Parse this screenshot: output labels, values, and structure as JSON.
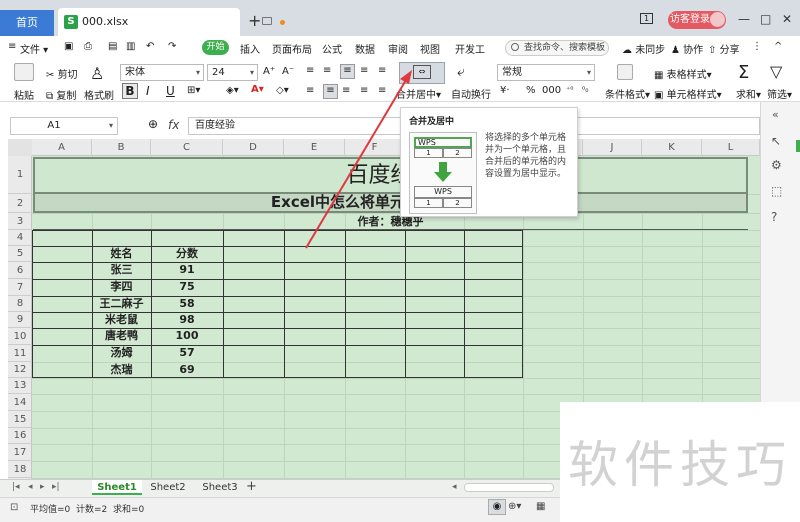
{
  "tabbar": {
    "home_label": "首页",
    "doc_label": "000.xlsx",
    "new_tab": "+",
    "login_label": "访客登录",
    "win_min": "—",
    "win_max": "□",
    "win_close": "✕",
    "win_badge": "1"
  },
  "menu": {
    "file": "文件",
    "start": "开始",
    "items": [
      "插入",
      "页面布局",
      "公式",
      "数据",
      "审阅",
      "视图",
      "开发工"
    ],
    "search": "查找命令、搜索模板",
    "unsync": "未同步",
    "collab": "协作",
    "share": "分享"
  },
  "ribbon": {
    "cut": "剪切",
    "paste": "粘贴",
    "copy": "复制",
    "format_painter": "格式刷",
    "font_name": "宋体",
    "font_size": "24",
    "bold": "B",
    "italic": "I",
    "underline": "U",
    "merge": "合并居中",
    "wrap": "自动换行",
    "number_format": "常规",
    "cond_format": "条件格式",
    "table_style": "表格样式",
    "cell_style": "单元格样式",
    "sum": "求和",
    "filter": "筛选"
  },
  "formula_bar": {
    "name_box": "A1",
    "fx": "fx",
    "value": "百度经验"
  },
  "columns": [
    "A",
    "B",
    "C",
    "D",
    "E",
    "F",
    "G",
    "H",
    "I",
    "J",
    "K",
    "L"
  ],
  "rows": [
    "1",
    "2",
    "3",
    "4",
    "5",
    "6",
    "7",
    "8",
    "9",
    "10",
    "11",
    "12",
    "13",
    "14",
    "15",
    "16",
    "17",
    "18"
  ],
  "sheet": {
    "title": "百度经验",
    "subtitle": "Excel中怎么将单元格合并并且居中",
    "author": "作者：穗穗乎",
    "table_headers": [
      "姓名",
      "分数"
    ],
    "table_rows": [
      [
        "张三",
        "91"
      ],
      [
        "李四",
        "75"
      ],
      [
        "王二麻子",
        "58"
      ],
      [
        "米老鼠",
        "98"
      ],
      [
        "唐老鸭",
        "100"
      ],
      [
        "汤姆",
        "57"
      ],
      [
        "杰瑞",
        "69"
      ]
    ]
  },
  "tooltip": {
    "title": "合并及居中",
    "desc": "将选择的多个单元格并为一个单元格，且合并后的单元格的内容设置为居中显示。",
    "wps1": "WPS",
    "wps2": "WPS",
    "n1": "1",
    "n2": "2"
  },
  "sheets": [
    "Sheet1",
    "Sheet2",
    "Sheet3"
  ],
  "status": {
    "summary": "平均值=0  计数=2  求和=0"
  },
  "watermark": "软件技巧",
  "colors": {
    "accent": "#3b7bd5",
    "sheet_bg": "#d1e8d1",
    "arrow": "#e0383e",
    "start_green": "#3fae4f"
  }
}
